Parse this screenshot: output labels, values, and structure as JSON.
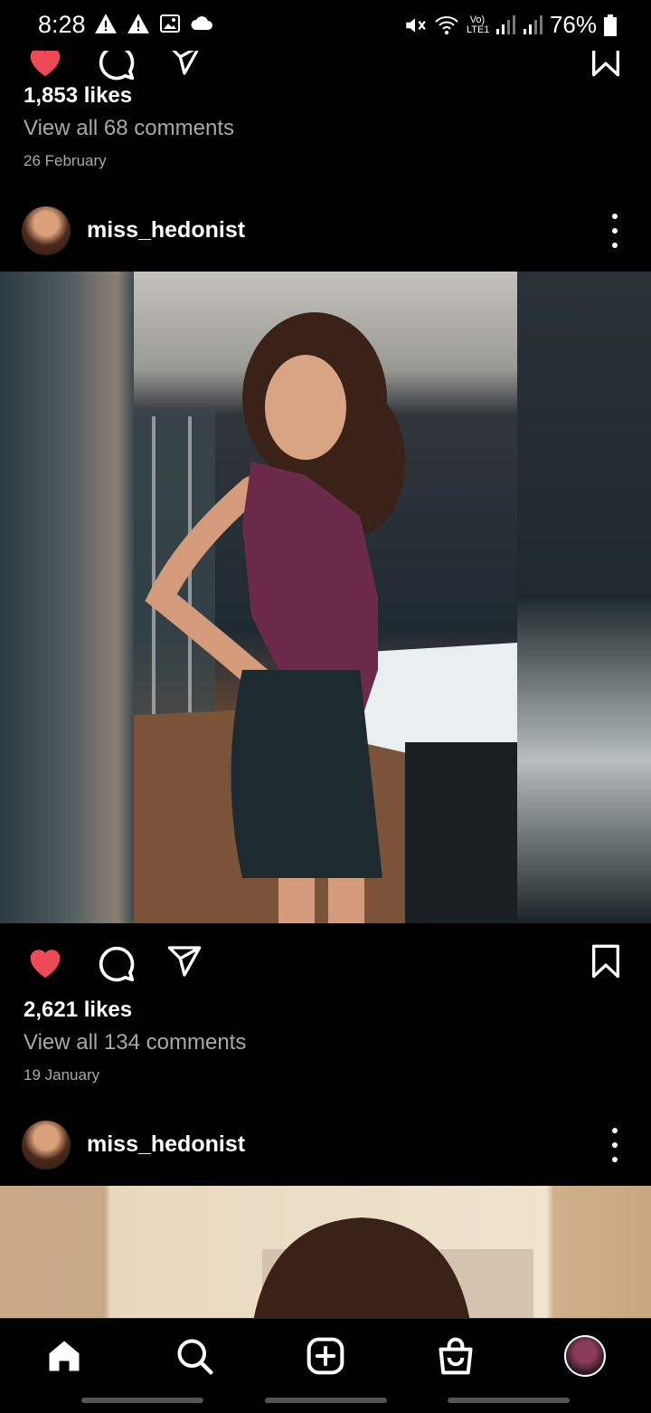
{
  "status_bar": {
    "time": "8:28",
    "battery": "76%",
    "network": "Vo) LTE1"
  },
  "posts": [
    {
      "likes": "1,853 likes",
      "comments_link": "View all 68 comments",
      "date": "26 February"
    },
    {
      "username": "miss_hedonist",
      "likes": "2,621 likes",
      "comments_link": "View all 134 comments",
      "date": "19 January",
      "liked": true
    },
    {
      "username": "miss_hedonist"
    }
  ],
  "icons": {
    "like": "heart-icon",
    "comment": "comment-icon",
    "share": "send-icon",
    "save": "bookmark-icon",
    "more": "more-vertical-icon"
  },
  "bottom_nav": [
    "home-icon",
    "search-icon",
    "add-post-icon",
    "shop-icon",
    "profile-avatar"
  ],
  "colors": {
    "like_red": "#ed4956",
    "background": "#000000",
    "secondary_text": "#a8a8a8"
  }
}
